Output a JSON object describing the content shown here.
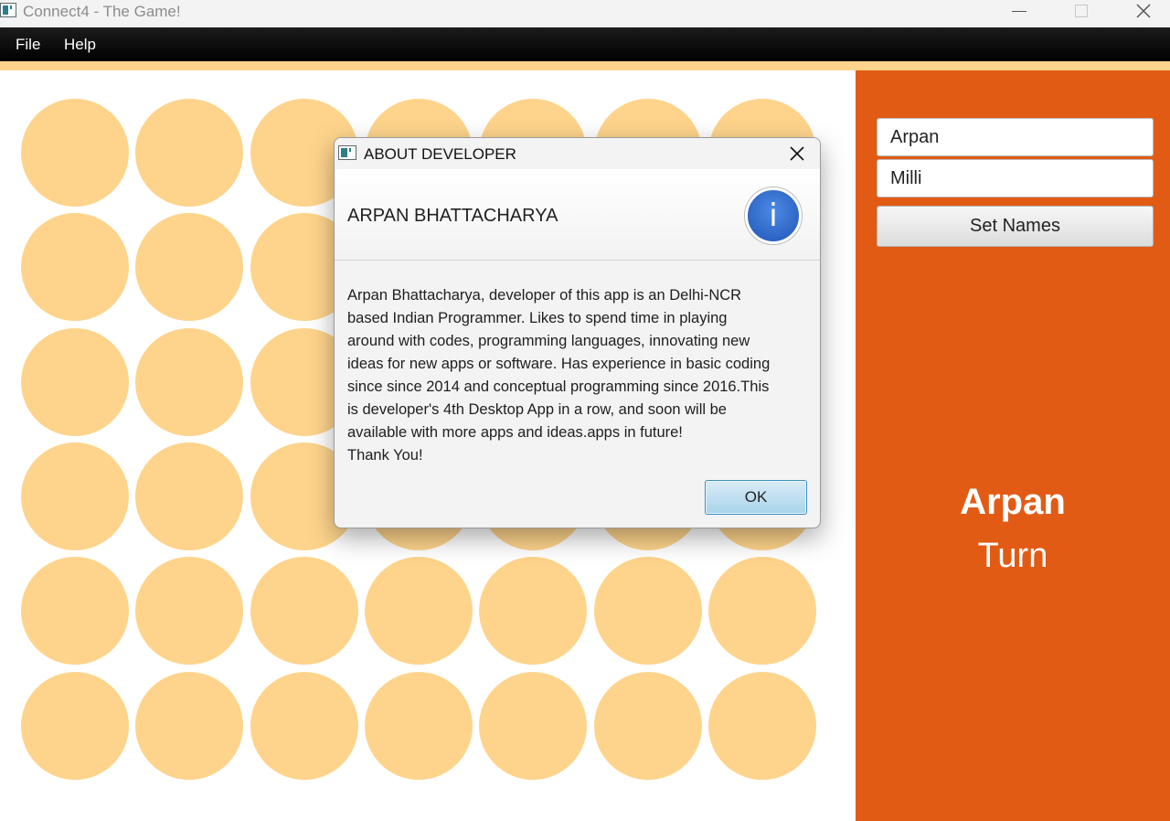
{
  "window": {
    "title": "Connect4 - The Game!"
  },
  "menu": {
    "items": [
      "File",
      "Help"
    ]
  },
  "board": {
    "rows": 6,
    "columns": 7,
    "disc_color": "#fed48c",
    "background": "#ffffff"
  },
  "side_panel": {
    "background": "#e25b15",
    "player_one": "Arpan",
    "player_two": "Milli",
    "set_names_label": "Set Names",
    "current_player": "Arpan",
    "turn_label": "Turn"
  },
  "dialog": {
    "title": "ABOUT DEVELOPER",
    "heading": "ARPAN BHATTACHARYA",
    "icon": "info-icon",
    "body": "Arpan Bhattacharya, developer of this app is an Delhi-NCR\nbased Indian Programmer. Likes to spend time in playing\naround with codes, programming languages, innovating new\nideas for new apps or software. Has experience in basic coding\nsince since 2014 and conceptual programming since 2016.This\nis developer's 4th Desktop App in a row, and soon will be\navailable with more apps and ideas.apps in future!\n Thank You!",
    "ok_label": "OK"
  }
}
